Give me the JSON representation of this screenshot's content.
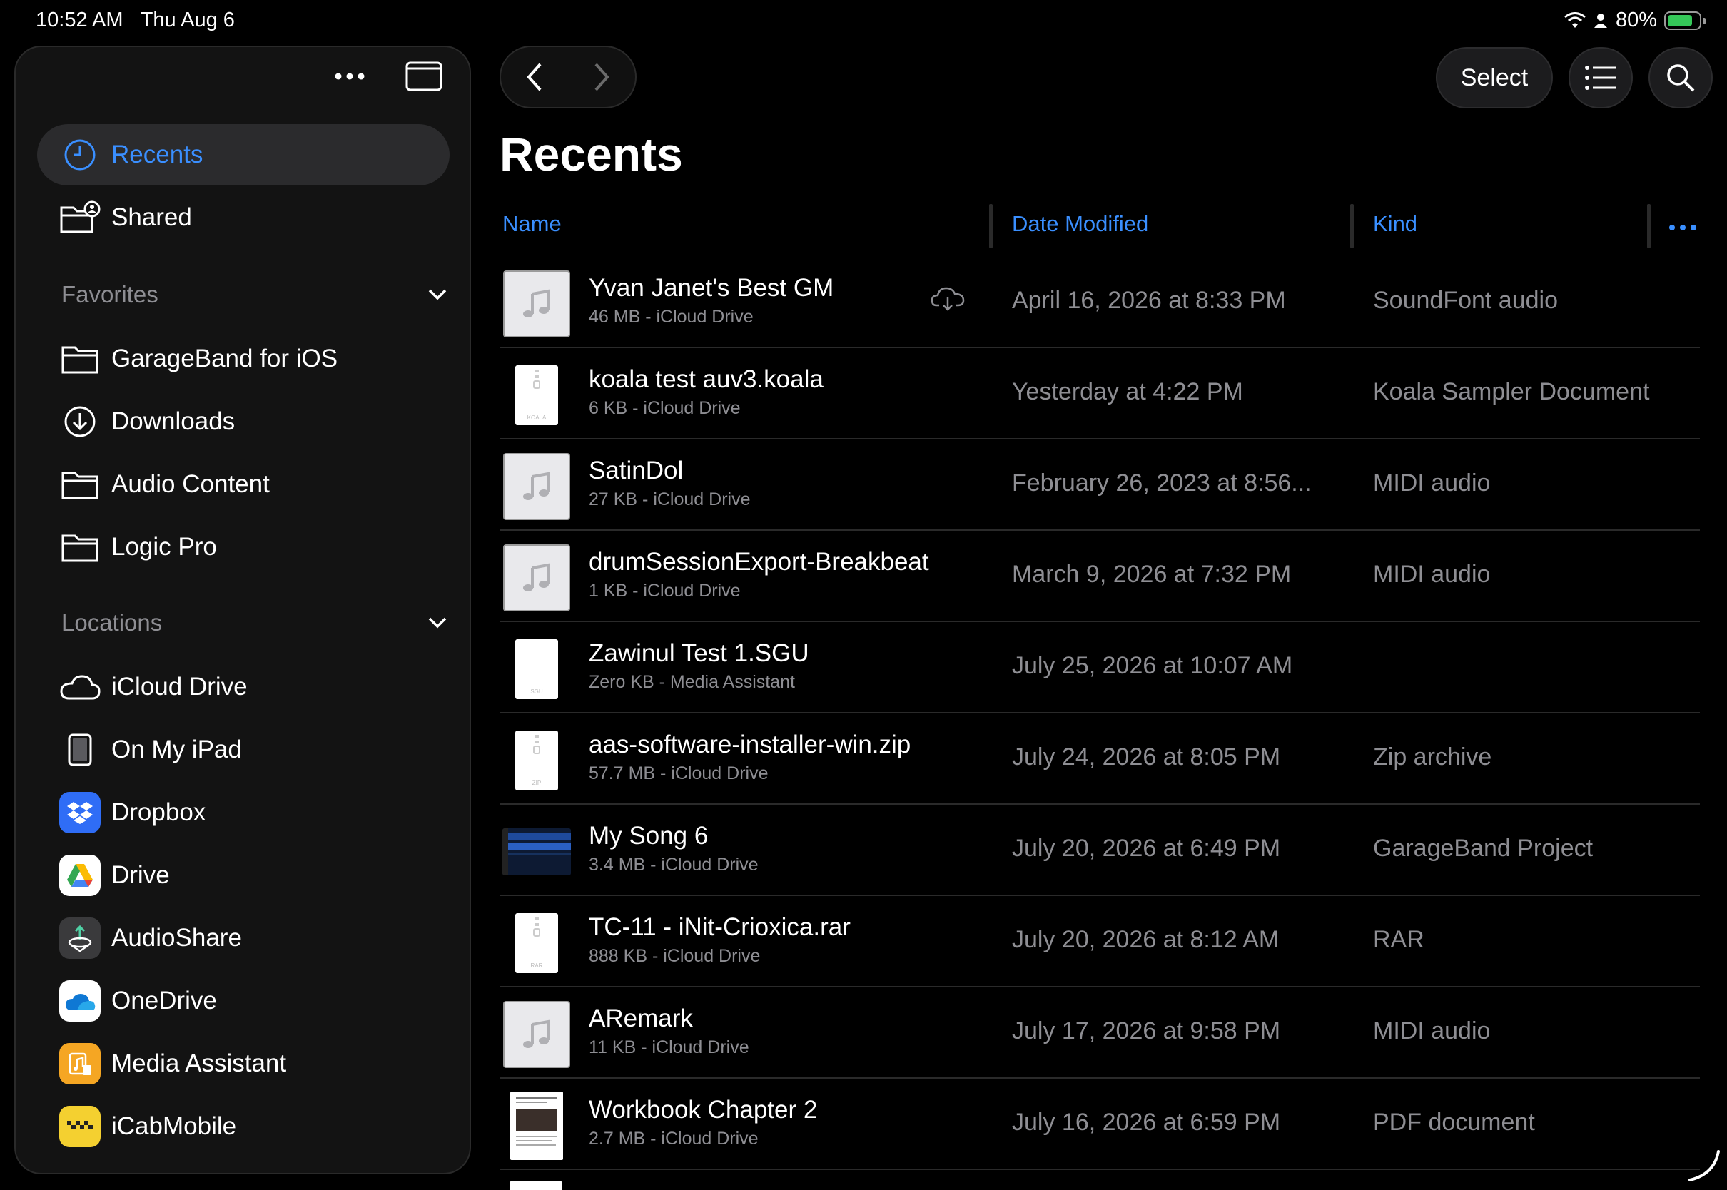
{
  "status_bar": {
    "time": "10:52 AM",
    "date": "Thu Aug 6",
    "battery_percent": "80%",
    "battery_level": 0.8
  },
  "sidebar": {
    "top_items": [
      {
        "label": "Recents",
        "icon": "clock-icon",
        "active": true
      },
      {
        "label": "Shared",
        "icon": "shared-folder-icon"
      }
    ],
    "favorites": {
      "title": "Favorites",
      "items": [
        {
          "label": "GarageBand for iOS",
          "icon": "folder-icon"
        },
        {
          "label": "Downloads",
          "icon": "download-icon"
        },
        {
          "label": "Audio Content",
          "icon": "folder-icon"
        },
        {
          "label": "Logic Pro",
          "icon": "folder-icon"
        }
      ]
    },
    "locations": {
      "title": "Locations",
      "items": [
        {
          "label": "iCloud Drive",
          "icon": "cloud-icon"
        },
        {
          "label": "On My iPad",
          "icon": "ipad-icon"
        },
        {
          "label": "Dropbox",
          "icon": "dropbox-icon"
        },
        {
          "label": "Drive",
          "icon": "google-drive-icon"
        },
        {
          "label": "AudioShare",
          "icon": "audioshare-icon"
        },
        {
          "label": "OneDrive",
          "icon": "onedrive-icon"
        },
        {
          "label": "Media Assistant",
          "icon": "media-assistant-icon"
        },
        {
          "label": "iCabMobile",
          "icon": "icabmobile-icon"
        }
      ]
    }
  },
  "toolbar": {
    "select_label": "Select"
  },
  "main": {
    "title": "Recents",
    "columns": {
      "name": "Name",
      "date": "Date Modified",
      "kind": "Kind"
    },
    "files": [
      {
        "name": "Yvan Janet's Best GM",
        "meta": "46 MB - iCloud Drive",
        "date": "April 16, 2026 at 8:33 PM",
        "kind": "SoundFont audio",
        "thumb": "audio",
        "cloud_download": true
      },
      {
        "name": "koala test auv3.koala",
        "meta": "6 KB - iCloud Drive",
        "date": "Yesterday at 4:22 PM",
        "kind": "Koala Sampler Document",
        "thumb": "zip",
        "ext": "KOALA"
      },
      {
        "name": "SatinDol",
        "meta": "27 KB - iCloud Drive",
        "date": "February 26, 2023 at 8:56...",
        "kind": "MIDI audio",
        "thumb": "audio"
      },
      {
        "name": "drumSessionExport-Breakbeat",
        "meta": "1 KB - iCloud Drive",
        "date": "March 9, 2026 at 7:32 PM",
        "kind": "MIDI audio",
        "thumb": "audio"
      },
      {
        "name": "Zawinul Test 1.SGU",
        "meta": "Zero KB - Media Assistant",
        "date": "July 25, 2026 at 10:07 AM",
        "kind": "",
        "thumb": "doc",
        "ext": "SGU"
      },
      {
        "name": "aas-software-installer-win.zip",
        "meta": "57.7 MB - iCloud Drive",
        "date": "July 24, 2026 at 8:05 PM",
        "kind": "Zip archive",
        "thumb": "zip",
        "ext": "ZIP"
      },
      {
        "name": "My Song 6",
        "meta": "3.4 MB - iCloud Drive",
        "date": "July 20, 2026 at 6:49 PM",
        "kind": "GarageBand Project",
        "thumb": "garageband"
      },
      {
        "name": "TC-11 - iNit-Crioxica.rar",
        "meta": "888 KB - iCloud Drive",
        "date": "July 20, 2026 at 8:12 AM",
        "kind": "RAR",
        "thumb": "zip",
        "ext": "RAR"
      },
      {
        "name": "ARemark",
        "meta": "11 KB - iCloud Drive",
        "date": "July 17, 2026 at 9:58 PM",
        "kind": "MIDI audio",
        "thumb": "audio"
      },
      {
        "name": "Workbook Chapter 2",
        "meta": "2.7 MB - iCloud Drive",
        "date": "July 16, 2026 at 6:59 PM",
        "kind": "PDF document",
        "thumb": "pdf"
      }
    ]
  }
}
